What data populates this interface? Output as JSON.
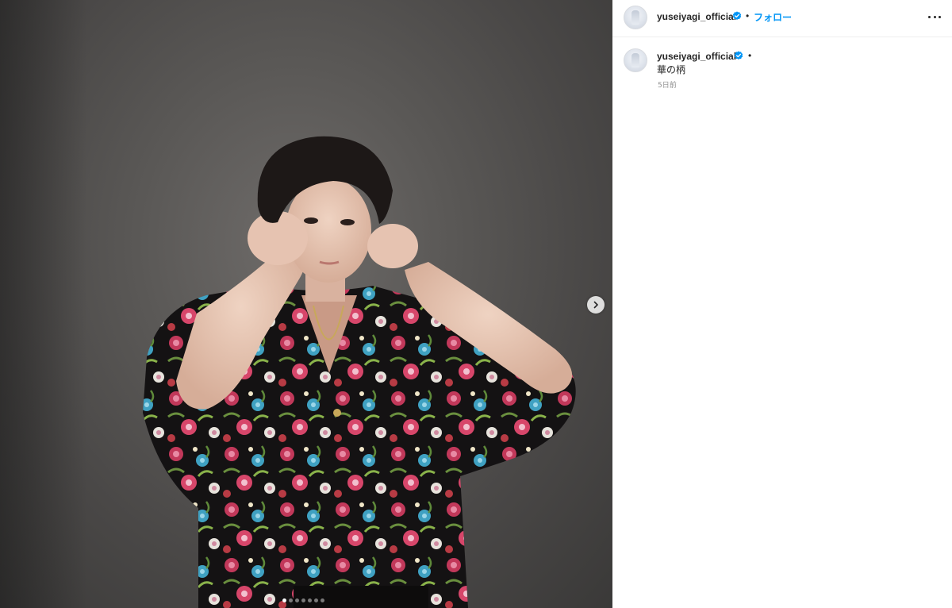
{
  "post": {
    "username": "yuseiyagi_official",
    "verified": true,
    "follow_label": "フォロー",
    "separator": "•",
    "caption": "華の柄",
    "timestamp": "5日前",
    "carousel": {
      "total": 7,
      "current": 1
    }
  },
  "icons": {
    "verified": "verified-badge-icon",
    "more": "more-options-icon",
    "next": "chevron-right-icon"
  },
  "colors": {
    "follow_blue": "#0095f6",
    "verified_blue": "#0095f6",
    "text": "#262626",
    "muted": "#8e8e8e"
  }
}
